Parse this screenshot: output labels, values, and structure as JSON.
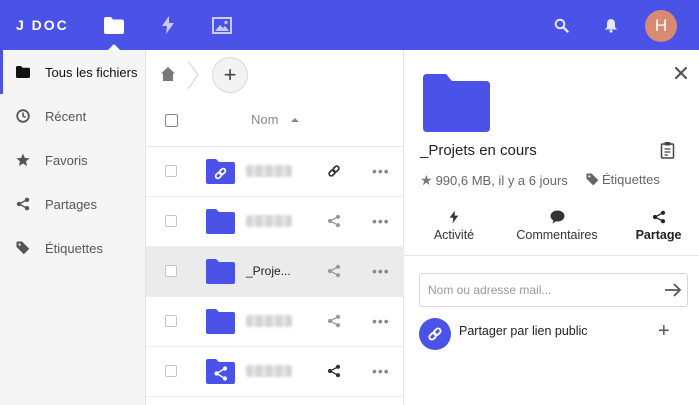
{
  "topbar": {
    "logo": "J DOC",
    "apps": [
      {
        "name": "folder-icon",
        "active": true
      },
      {
        "name": "activity-icon",
        "active": false
      },
      {
        "name": "gallery-icon",
        "active": false
      }
    ],
    "avatar_initial": "H",
    "accent": "#4a52e8"
  },
  "sidebar": {
    "items": [
      {
        "label": "Tous les fichiers",
        "icon": "folder-icon",
        "active": true
      },
      {
        "label": "Récent",
        "icon": "clock-icon",
        "active": false
      },
      {
        "label": "Favoris",
        "icon": "star-icon",
        "active": false
      },
      {
        "label": "Partages",
        "icon": "share-icon",
        "active": false
      },
      {
        "label": "Étiquettes",
        "icon": "tag-icon",
        "active": false
      }
    ]
  },
  "files": {
    "add_label": "+",
    "header": {
      "name": "Nom"
    },
    "rows": [
      {
        "name": "",
        "type": "link-folder",
        "action": "link-icon",
        "selected": false
      },
      {
        "name": "",
        "type": "folder",
        "action": "share-icon",
        "selected": false
      },
      {
        "name": "_Proje...",
        "type": "folder",
        "action": "share-icon",
        "selected": true
      },
      {
        "name": "",
        "type": "folder",
        "action": "share-icon",
        "selected": false
      },
      {
        "name": "",
        "type": "shared-folder",
        "action": "share-icon",
        "selected": false
      }
    ],
    "more_label": "•••"
  },
  "details": {
    "title": "_Projets en cours",
    "meta": "990,6 MB, il y a 6 jours",
    "tags_label": "Étiquettes",
    "tabs": [
      {
        "label": "Activité",
        "icon": "activity-icon",
        "active": false
      },
      {
        "label": "Commentaires",
        "icon": "comment-icon",
        "active": false
      },
      {
        "label": "Partage",
        "icon": "share-icon",
        "active": true
      }
    ],
    "share_placeholder": "Nom ou adresse mail...",
    "public_link_label": "Partager par lien public",
    "add_label": "+"
  }
}
